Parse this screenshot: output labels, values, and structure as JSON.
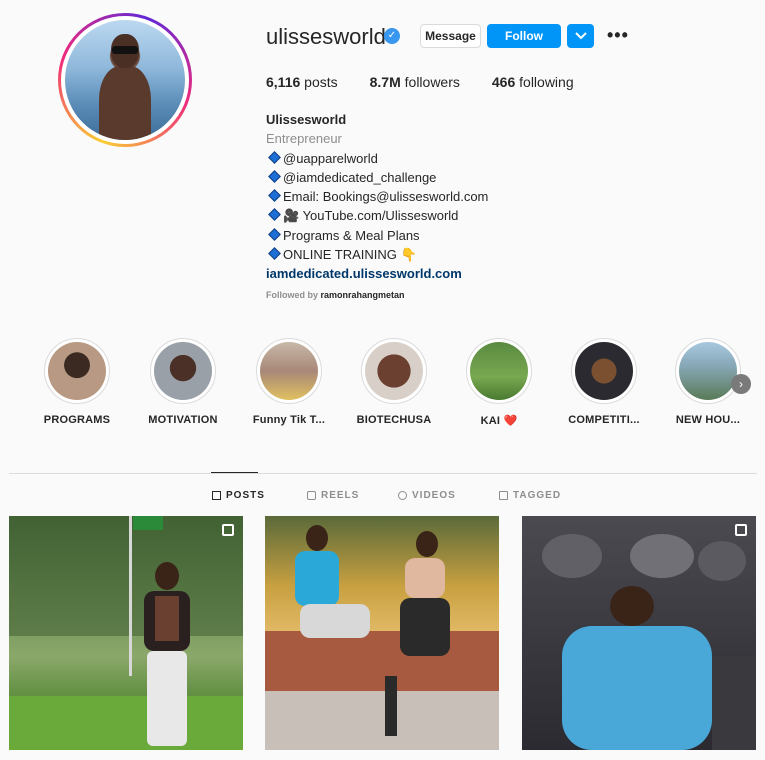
{
  "profile": {
    "username": "ulissesworld",
    "message_label": "Message",
    "follow_label": "Follow",
    "dropdown_glyph": "⌄",
    "more_glyph": "•••",
    "verified_glyph": "✓"
  },
  "stats": {
    "posts_count": "6,116",
    "posts_label": "posts",
    "followers_count": "8.7M",
    "followers_label": "followers",
    "following_count": "466",
    "following_label": "following"
  },
  "bio": {
    "name": "Ulissesworld",
    "category": "Entrepreneur",
    "lines": [
      "@uapparelworld",
      "@iamdedicated_challenge",
      "Email: Bookings@ulissesworld.com",
      "🎥 YouTube.com/Ulissesworld",
      "Programs & Meal Plans",
      "ONLINE TRAINING 👇"
    ],
    "website": "iamdedicated.ulissesworld.com",
    "followed_prefix": "Followed by",
    "followed_user": "ramonrahangmetan"
  },
  "highlights": [
    {
      "label": "PROGRAMS",
      "color": "#8a6a58"
    },
    {
      "label": "MOTIVATION",
      "color": "#7a6a60"
    },
    {
      "label": "Funny Tik T...",
      "color": "#c0a896"
    },
    {
      "label": "BIOTECHUSA",
      "color": "#6b4a3a"
    },
    {
      "label": "KAI ❤️",
      "color": "#6a9a4a"
    },
    {
      "label": "COMPETITI...",
      "color": "#4a4a50"
    },
    {
      "label": "NEW HOU...",
      "color": "#7a9ab0"
    }
  ],
  "highlights_next_glyph": "›",
  "tabs": [
    {
      "label": "POSTS",
      "active": true
    },
    {
      "label": "REELS",
      "active": false
    },
    {
      "label": "VIDEOS",
      "active": false
    },
    {
      "label": "TAGGED",
      "active": false
    }
  ],
  "colors": {
    "accent": "#0095f6",
    "verified": "#3897f0",
    "link": "#00376b",
    "muted": "#8e8e8e"
  }
}
